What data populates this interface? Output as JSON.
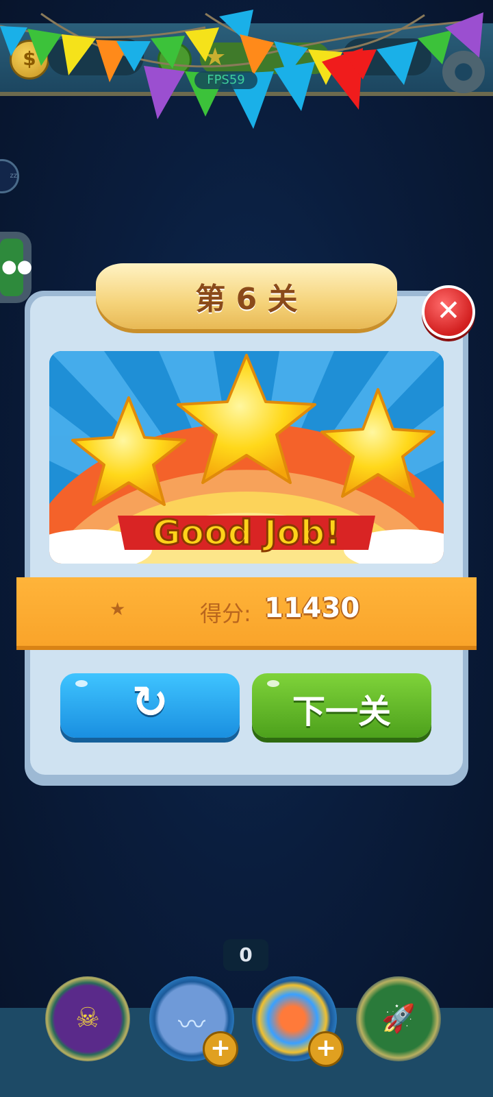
{
  "hud": {
    "fps": "FPS59"
  },
  "dialog": {
    "title": "第 6 关",
    "banner_text": "Good Job!",
    "score_label": "得分:",
    "score_value": "11430",
    "next_label": "下一关",
    "stars_earned": 3,
    "stars_total": 3
  },
  "counter": {
    "value": "0"
  },
  "icons": {
    "close": "close-icon",
    "replay": "replay-icon",
    "score_star": "star-icon",
    "coin": "coin-icon",
    "settings": "gear-icon",
    "chat": "wechat-icon"
  },
  "colors": {
    "background": "#0a1d3d",
    "panel": "#cfe2f1",
    "score_bar": "#f9a42a",
    "replay_button": "#1a8fe0",
    "next_button": "#4da11c",
    "close_button": "#d21f1f"
  }
}
